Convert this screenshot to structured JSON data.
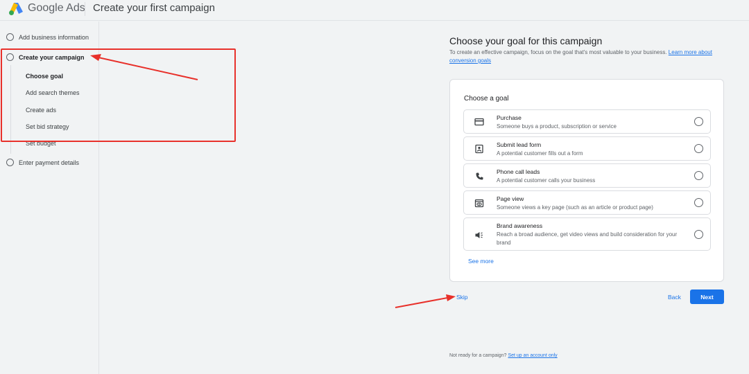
{
  "header": {
    "brand": "Google Ads",
    "title": "Create your first campaign"
  },
  "sidebar": {
    "steps": [
      {
        "label": "Add business information"
      },
      {
        "label": "Create your campaign"
      },
      {
        "label": "Enter payment details"
      }
    ],
    "substeps": [
      {
        "label": "Choose goal"
      },
      {
        "label": "Add search themes"
      },
      {
        "label": "Create ads"
      },
      {
        "label": "Set bid strategy"
      },
      {
        "label": "Set budget"
      }
    ]
  },
  "main": {
    "title": "Choose your goal for this campaign",
    "description": "To create an effective campaign, focus on the goal that's most valuable to your business.",
    "learn_more": "Learn more about conversion goals",
    "card_title": "Choose a goal",
    "options": [
      {
        "title": "Purchase",
        "desc": "Someone buys a product, subscription or service",
        "icon": "credit-card-icon"
      },
      {
        "title": "Submit lead form",
        "desc": "A potential customer fills out a form",
        "icon": "contact-form-icon"
      },
      {
        "title": "Phone call leads",
        "desc": "A potential customer calls your business",
        "icon": "phone-icon"
      },
      {
        "title": "Page view",
        "desc": "Someone views a key page (such as an article or product page)",
        "icon": "page-view-icon"
      },
      {
        "title": "Brand awareness",
        "desc": "Reach a broad audience, get video views and build consideration for your brand",
        "icon": "megaphone-icon"
      }
    ],
    "see_more": "See more",
    "skip": "Skip",
    "back": "Back",
    "next": "Next"
  },
  "footer": {
    "text": "Not ready for a campaign?",
    "link": "Set up an account only"
  },
  "colors": {
    "accent": "#1a73e8",
    "annotation": "#e8302a",
    "background": "#f1f3f4"
  }
}
